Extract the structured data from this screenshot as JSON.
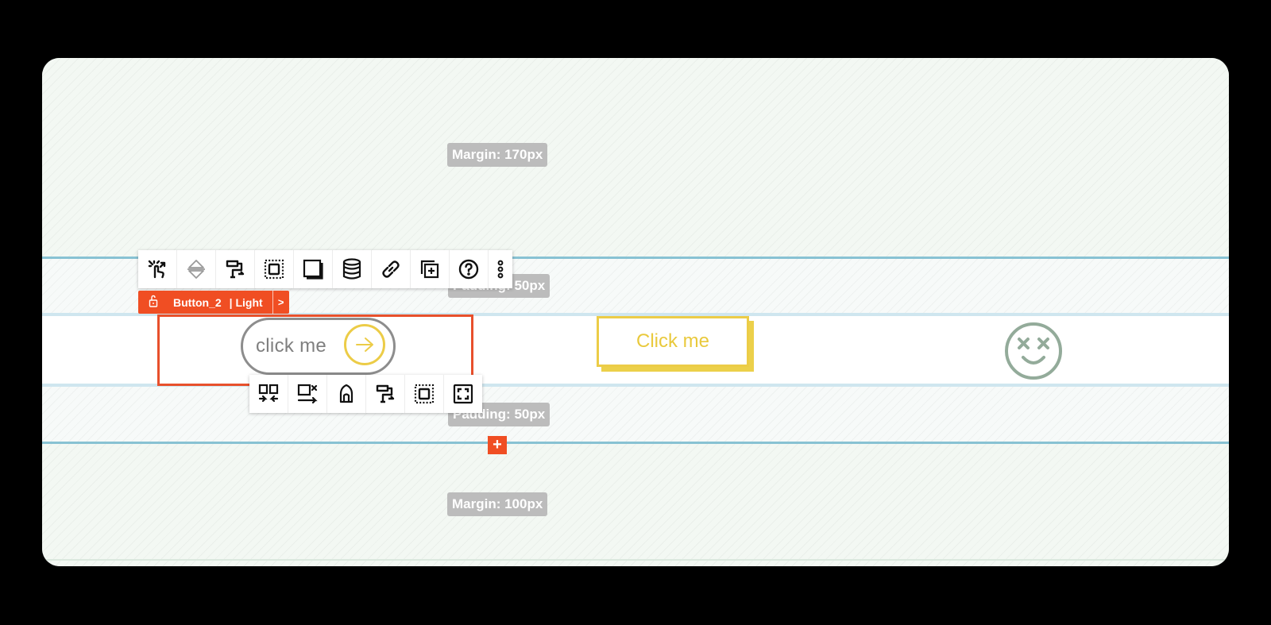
{
  "spacing_labels": {
    "margin_top": "Margin: 170px",
    "padding_top": "Padding: 50px",
    "padding_bottom": "Padding: 50px",
    "margin_bottom": "Margin: 100px"
  },
  "element_toolbar": {
    "icons": [
      "magic-pointer-icon",
      "vertical-align-icon",
      "paint-format-icon",
      "padding-icon",
      "shadow-icon",
      "database-icon",
      "link-icon",
      "add-layer-icon",
      "help-icon",
      "more-vertical-icon"
    ]
  },
  "breadcrumb": {
    "lock_icon": "unlock-icon",
    "name": "Button_2",
    "variant": "| Light",
    "next": ">"
  },
  "row_toolbar": {
    "icons": [
      "columns-icon",
      "move-row-icon",
      "bucket-icon",
      "paint-format-icon",
      "padding-icon",
      "fullscreen-icon"
    ]
  },
  "buttons": {
    "pill_label": "click me",
    "shadow_label": "Click me"
  },
  "add_button": "+",
  "colors": {
    "accent": "#f04e23",
    "yellow": "#eccc47",
    "guide_blue": "#88c2d3",
    "smiley": "#93ab9a"
  }
}
